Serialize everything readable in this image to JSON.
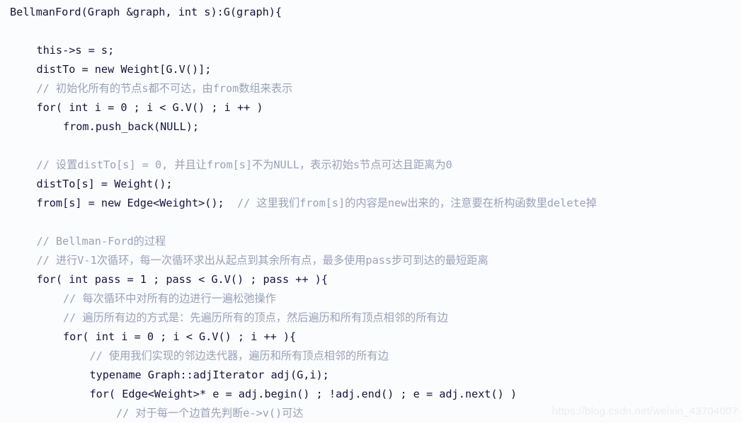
{
  "code_block": {
    "language": "cpp",
    "background_color": "#fbfcfe",
    "code_color": "#14143c",
    "comment_color": "#9aa1b8",
    "lines": [
      {
        "indent": 0,
        "segments": [
          {
            "kind": "code",
            "text": "BellmanFord(Graph &graph, int s):G(graph){"
          }
        ]
      },
      {
        "indent": 0,
        "segments": []
      },
      {
        "indent": 1,
        "segments": [
          {
            "kind": "code",
            "text": "this->s = s;"
          }
        ]
      },
      {
        "indent": 1,
        "segments": [
          {
            "kind": "code",
            "text": "distTo = new Weight[G.V()];"
          }
        ]
      },
      {
        "indent": 1,
        "segments": [
          {
            "kind": "comment",
            "text": "// 初始化所有的节点s都不可达，由from数组来表示"
          }
        ]
      },
      {
        "indent": 1,
        "segments": [
          {
            "kind": "code",
            "text": "for( int i = 0 ; i < G.V() ; i ++ )"
          }
        ]
      },
      {
        "indent": 2,
        "segments": [
          {
            "kind": "code",
            "text": "from.push_back(NULL);"
          }
        ]
      },
      {
        "indent": 0,
        "segments": []
      },
      {
        "indent": 1,
        "segments": [
          {
            "kind": "comment",
            "text": "// 设置distTo[s] = 0, 并且让from[s]不为NULL，表示初始s节点可达且距离为0"
          }
        ]
      },
      {
        "indent": 1,
        "segments": [
          {
            "kind": "code",
            "text": "distTo[s] = Weight();"
          }
        ]
      },
      {
        "indent": 1,
        "segments": [
          {
            "kind": "code",
            "text": "from[s] = new Edge<Weight>();  "
          },
          {
            "kind": "comment",
            "text": "// 这里我们from[s]的内容是new出来的，注意要在析构函数里delete掉"
          }
        ]
      },
      {
        "indent": 0,
        "segments": []
      },
      {
        "indent": 1,
        "segments": [
          {
            "kind": "comment",
            "text": "// Bellman-Ford的过程"
          }
        ]
      },
      {
        "indent": 1,
        "segments": [
          {
            "kind": "comment",
            "text": "// 进行V-1次循环，每一次循环求出从起点到其余所有点，最多使用pass步可到达的最短距离"
          }
        ]
      },
      {
        "indent": 1,
        "segments": [
          {
            "kind": "code",
            "text": "for( int pass = 1 ; pass < G.V() ; pass ++ ){"
          }
        ]
      },
      {
        "indent": 2,
        "segments": [
          {
            "kind": "comment",
            "text": "// 每次循环中对所有的边进行一遍松弛操作"
          }
        ]
      },
      {
        "indent": 2,
        "segments": [
          {
            "kind": "comment",
            "text": "// 遍历所有边的方式是：先遍历所有的顶点，然后遍历和所有顶点相邻的所有边"
          }
        ]
      },
      {
        "indent": 2,
        "segments": [
          {
            "kind": "code",
            "text": "for( int i = 0 ; i < G.V() ; i ++ ){"
          }
        ]
      },
      {
        "indent": 3,
        "segments": [
          {
            "kind": "comment",
            "text": "// 使用我们实现的邻边迭代器，遍历和所有顶点相邻的所有边"
          }
        ]
      },
      {
        "indent": 3,
        "segments": [
          {
            "kind": "code",
            "text": "typename Graph::adjIterator adj(G,i);"
          }
        ]
      },
      {
        "indent": 3,
        "segments": [
          {
            "kind": "code",
            "text": "for( Edge<Weight>* e = adj.begin() ; !adj.end() ; e = adj.next() )"
          }
        ]
      },
      {
        "indent": 4,
        "segments": [
          {
            "kind": "comment",
            "text": "// 对于每一个边首先判断e->v()可达"
          }
        ]
      }
    ]
  },
  "watermark": {
    "text": "https://blog.csdn.net/weixin_43704007"
  }
}
